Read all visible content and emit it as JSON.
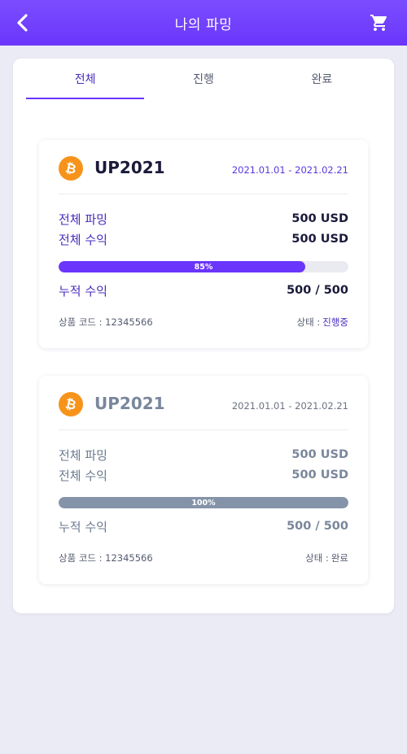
{
  "header": {
    "title": "나의 파밍",
    "back_icon": "chevron-left-icon",
    "cart_icon": "shopping-cart-icon"
  },
  "tabs": [
    {
      "label": "전체",
      "active": true
    },
    {
      "label": "진행",
      "active": false
    },
    {
      "label": "완료",
      "active": false
    }
  ],
  "colors": {
    "accent": "#6a36fb",
    "coin": "#f7931a",
    "completed": "#8593a8"
  },
  "farmings": [
    {
      "coin_icon": "bitcoin-icon",
      "name": "UP2021",
      "period": "2021.01.01 - 2021.02.21",
      "total_farming_label": "전체 파밍",
      "total_farming_value": "500 USD",
      "total_profit_label": "전체 수익",
      "total_profit_value": "500 USD",
      "progress": 85,
      "progress_label": "85%",
      "cumulative_label": "누적 수익",
      "cumulative_value": "500 / 500",
      "product_code": "상품 코드 : 12345566",
      "status_label": "상태 :",
      "status_value": "진행중"
    },
    {
      "coin_icon": "bitcoin-icon",
      "name": "UP2021",
      "period": "2021.01.01 - 2021.02.21",
      "total_farming_label": "전체 파밍",
      "total_farming_value": "500 USD",
      "total_profit_label": "전체 수익",
      "total_profit_value": "500 USD",
      "progress": 100,
      "progress_label": "100%",
      "cumulative_label": "누적 수익",
      "cumulative_value": "500 / 500",
      "product_code": "상품 코드 : 12345566",
      "status_label": "상태 :",
      "status_value": "완료"
    }
  ]
}
